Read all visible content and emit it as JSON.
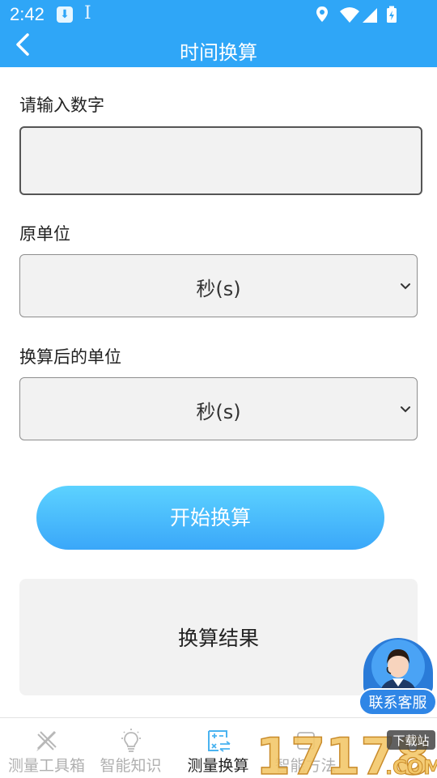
{
  "status_bar": {
    "time": "2:42"
  },
  "app_bar": {
    "title": "时间换算"
  },
  "form": {
    "number_label": "请输入数字",
    "number_value": "",
    "source_unit_label": "原单位",
    "source_unit_value": "秒(s)",
    "target_unit_label": "换算后的单位",
    "target_unit_value": "秒(s)",
    "convert_button": "开始换算",
    "result_text": "换算结果"
  },
  "customer_service": {
    "label": "联系客服"
  },
  "tabs": [
    {
      "label": "测量工具箱",
      "icon": "ruler-pencil-icon",
      "active": false
    },
    {
      "label": "智能知识",
      "icon": "lightbulb-icon",
      "active": false
    },
    {
      "label": "测量换算",
      "icon": "calculator-icon",
      "active": true
    },
    {
      "label": "智能方法",
      "icon": "method-icon",
      "active": false
    }
  ],
  "watermark": {
    "text": "17178",
    "suffix": ".COM",
    "badge": "下载站"
  },
  "colors": {
    "accent": "#2fa6f7",
    "button_top": "#5cd2ff",
    "button_bottom": "#3aa7f9"
  }
}
